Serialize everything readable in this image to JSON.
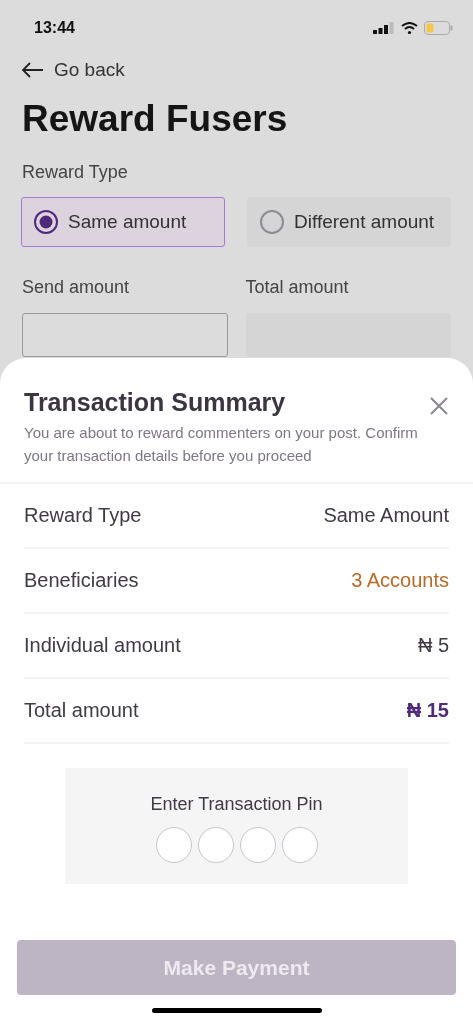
{
  "status_bar": {
    "time": "13:44"
  },
  "nav": {
    "back_label": "Go back"
  },
  "title": "Reward Fusers",
  "reward_type": {
    "label": "Reward Type",
    "options": [
      {
        "label": "Same amount",
        "selected": true
      },
      {
        "label": "Different amount",
        "selected": false
      }
    ]
  },
  "amount_fields": [
    {
      "label": "Send amount",
      "disabled": false
    },
    {
      "label": "Total amount",
      "disabled": true
    }
  ],
  "sheet": {
    "title": "Transaction Summary",
    "subtitle": "You are about to reward commenters on your post. Confirm your transaction details before you proceed",
    "rows": [
      {
        "label": "Reward Type",
        "value": "Same Amount",
        "kind": "plain"
      },
      {
        "label": "Beneficiaries",
        "value": "3 Accounts",
        "kind": "accent"
      },
      {
        "label": "Individual amount",
        "value": "₦ 5",
        "kind": "plain"
      },
      {
        "label": "Total amount",
        "value": "₦ 15",
        "kind": "total"
      }
    ],
    "pin": {
      "label": "Enter Transaction Pin",
      "cells": [
        {
          "filled": false
        },
        {
          "filled": false
        },
        {
          "filled": false
        },
        {
          "filled": false
        }
      ]
    },
    "button": {
      "label": "Make Payment",
      "disabled": true
    }
  }
}
